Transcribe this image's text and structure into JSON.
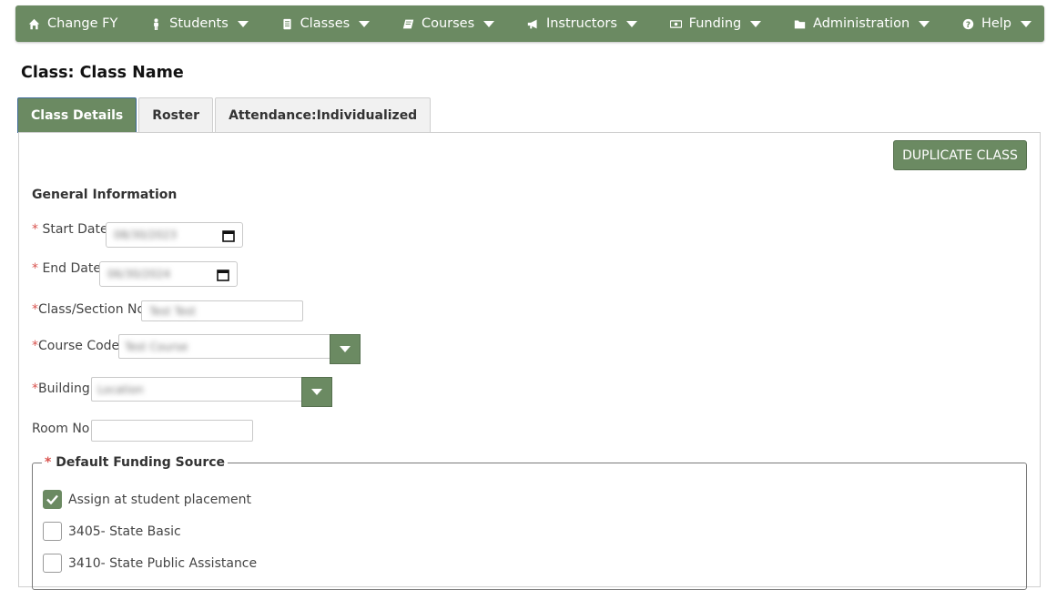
{
  "nav": {
    "items": [
      {
        "label": "Change FY",
        "icon": "home-icon",
        "dropdown": false
      },
      {
        "label": "Students",
        "icon": "student-icon",
        "dropdown": true
      },
      {
        "label": "Classes",
        "icon": "classes-icon",
        "dropdown": true
      },
      {
        "label": "Courses",
        "icon": "book-icon",
        "dropdown": true
      },
      {
        "label": "Instructors",
        "icon": "megaphone-icon",
        "dropdown": true
      },
      {
        "label": "Funding",
        "icon": "money-icon",
        "dropdown": true
      },
      {
        "label": "Administration",
        "icon": "folder-icon",
        "dropdown": true
      },
      {
        "label": "Help",
        "icon": "question-icon",
        "dropdown": true
      }
    ]
  },
  "page": {
    "title": "Class: Class Name"
  },
  "tabs": [
    {
      "label": "Class Details",
      "active": true
    },
    {
      "label": "Roster",
      "active": false
    },
    {
      "label": "Attendance:Individualized",
      "active": false
    }
  ],
  "actions": {
    "duplicate_label": "DUPLICATE CLASS"
  },
  "form": {
    "section_title": "General Information",
    "start_date": {
      "required_mark": "*",
      "label": "Start Date",
      "value": "08/30/2023"
    },
    "end_date": {
      "required_mark": "*",
      "label": "End Date",
      "value": "06/30/2024"
    },
    "section_no": {
      "required_mark": "*",
      "label": "Class/Section No",
      "value": "Test Test"
    },
    "course_code": {
      "required_mark": "*",
      "label": "Course Code",
      "value": "Test Course"
    },
    "building": {
      "required_mark": "*",
      "label": "Building",
      "value": "Location"
    },
    "room_no": {
      "label": "Room No",
      "value": ""
    }
  },
  "funding": {
    "required_mark": "*",
    "legend": "Default Funding Source",
    "options": [
      {
        "label": "Assign at student placement",
        "checked": true
      },
      {
        "label": "3405- State Basic",
        "checked": false
      },
      {
        "label": "3410- State Public Assistance",
        "checked": false
      }
    ]
  },
  "colors": {
    "brand_green": "#6b8a62",
    "required_red": "#d9534f",
    "tab_active_border": "#3e6a98"
  }
}
